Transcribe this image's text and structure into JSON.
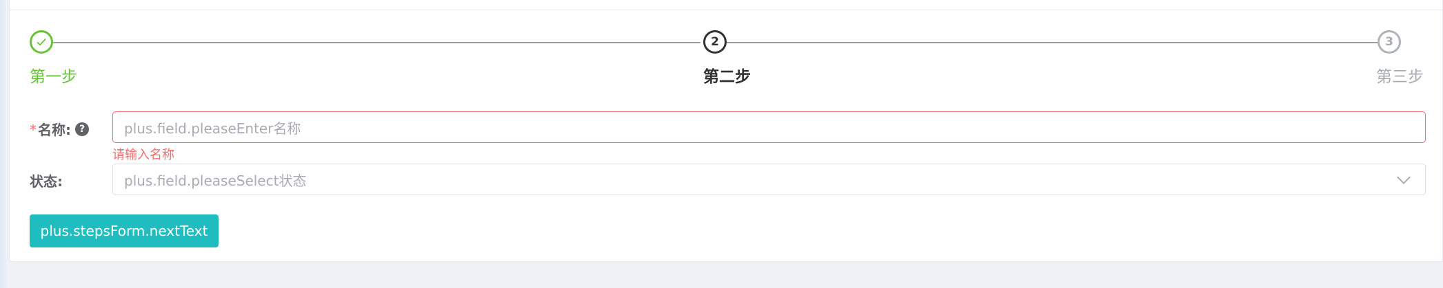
{
  "steps": [
    {
      "number": "",
      "title": "第一步",
      "status": "finished"
    },
    {
      "number": "2",
      "title": "第二步",
      "status": "active"
    },
    {
      "number": "3",
      "title": "第三步",
      "status": "waiting"
    }
  ],
  "form": {
    "name": {
      "required_mark": "*",
      "label": "名称:",
      "help_icon": "?",
      "placeholder": "plus.field.pleaseEnter名称",
      "error": "请输入名称"
    },
    "status": {
      "label": "状态:",
      "placeholder": "plus.field.pleaseSelect状态"
    }
  },
  "next_button": "plus.stepsForm.nextText",
  "colors": {
    "success": "#67c23a",
    "danger": "#f56c6c",
    "primary_button": "#1fbcc0"
  }
}
